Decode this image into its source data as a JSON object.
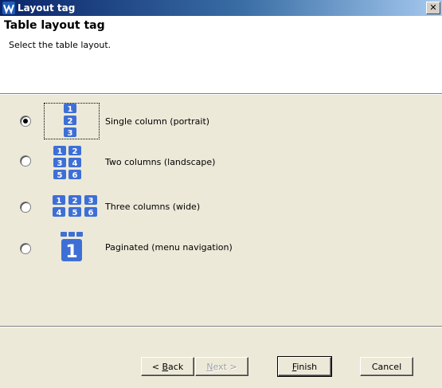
{
  "window": {
    "title": "Layout tag",
    "close_glyph": "✕"
  },
  "header": {
    "title": "Table layout tag",
    "description": "Select the table layout."
  },
  "options": [
    {
      "label": "Single column (portrait)",
      "selected": true,
      "icon": "single-column-layout-icon"
    },
    {
      "label": "Two columns (landscape)",
      "selected": false,
      "icon": "two-column-layout-icon"
    },
    {
      "label": "Three columns (wide)",
      "selected": false,
      "icon": "three-column-layout-icon"
    },
    {
      "label": "Paginated (menu navigation)",
      "selected": false,
      "icon": "paginated-layout-icon"
    }
  ],
  "buttons": {
    "back": {
      "mnemonic": "B",
      "pre": "< ",
      "rest": "ack"
    },
    "next": {
      "mnemonic": "N",
      "pre": "",
      "rest": "ext >"
    },
    "finish": {
      "mnemonic": "F",
      "pre": "",
      "rest": "inish"
    },
    "cancel": "Cancel"
  },
  "colors": {
    "title_gradient_start": "#0a246a",
    "tile_blue": "#3d6fd6",
    "dialog_bg": "#ece9d8"
  }
}
